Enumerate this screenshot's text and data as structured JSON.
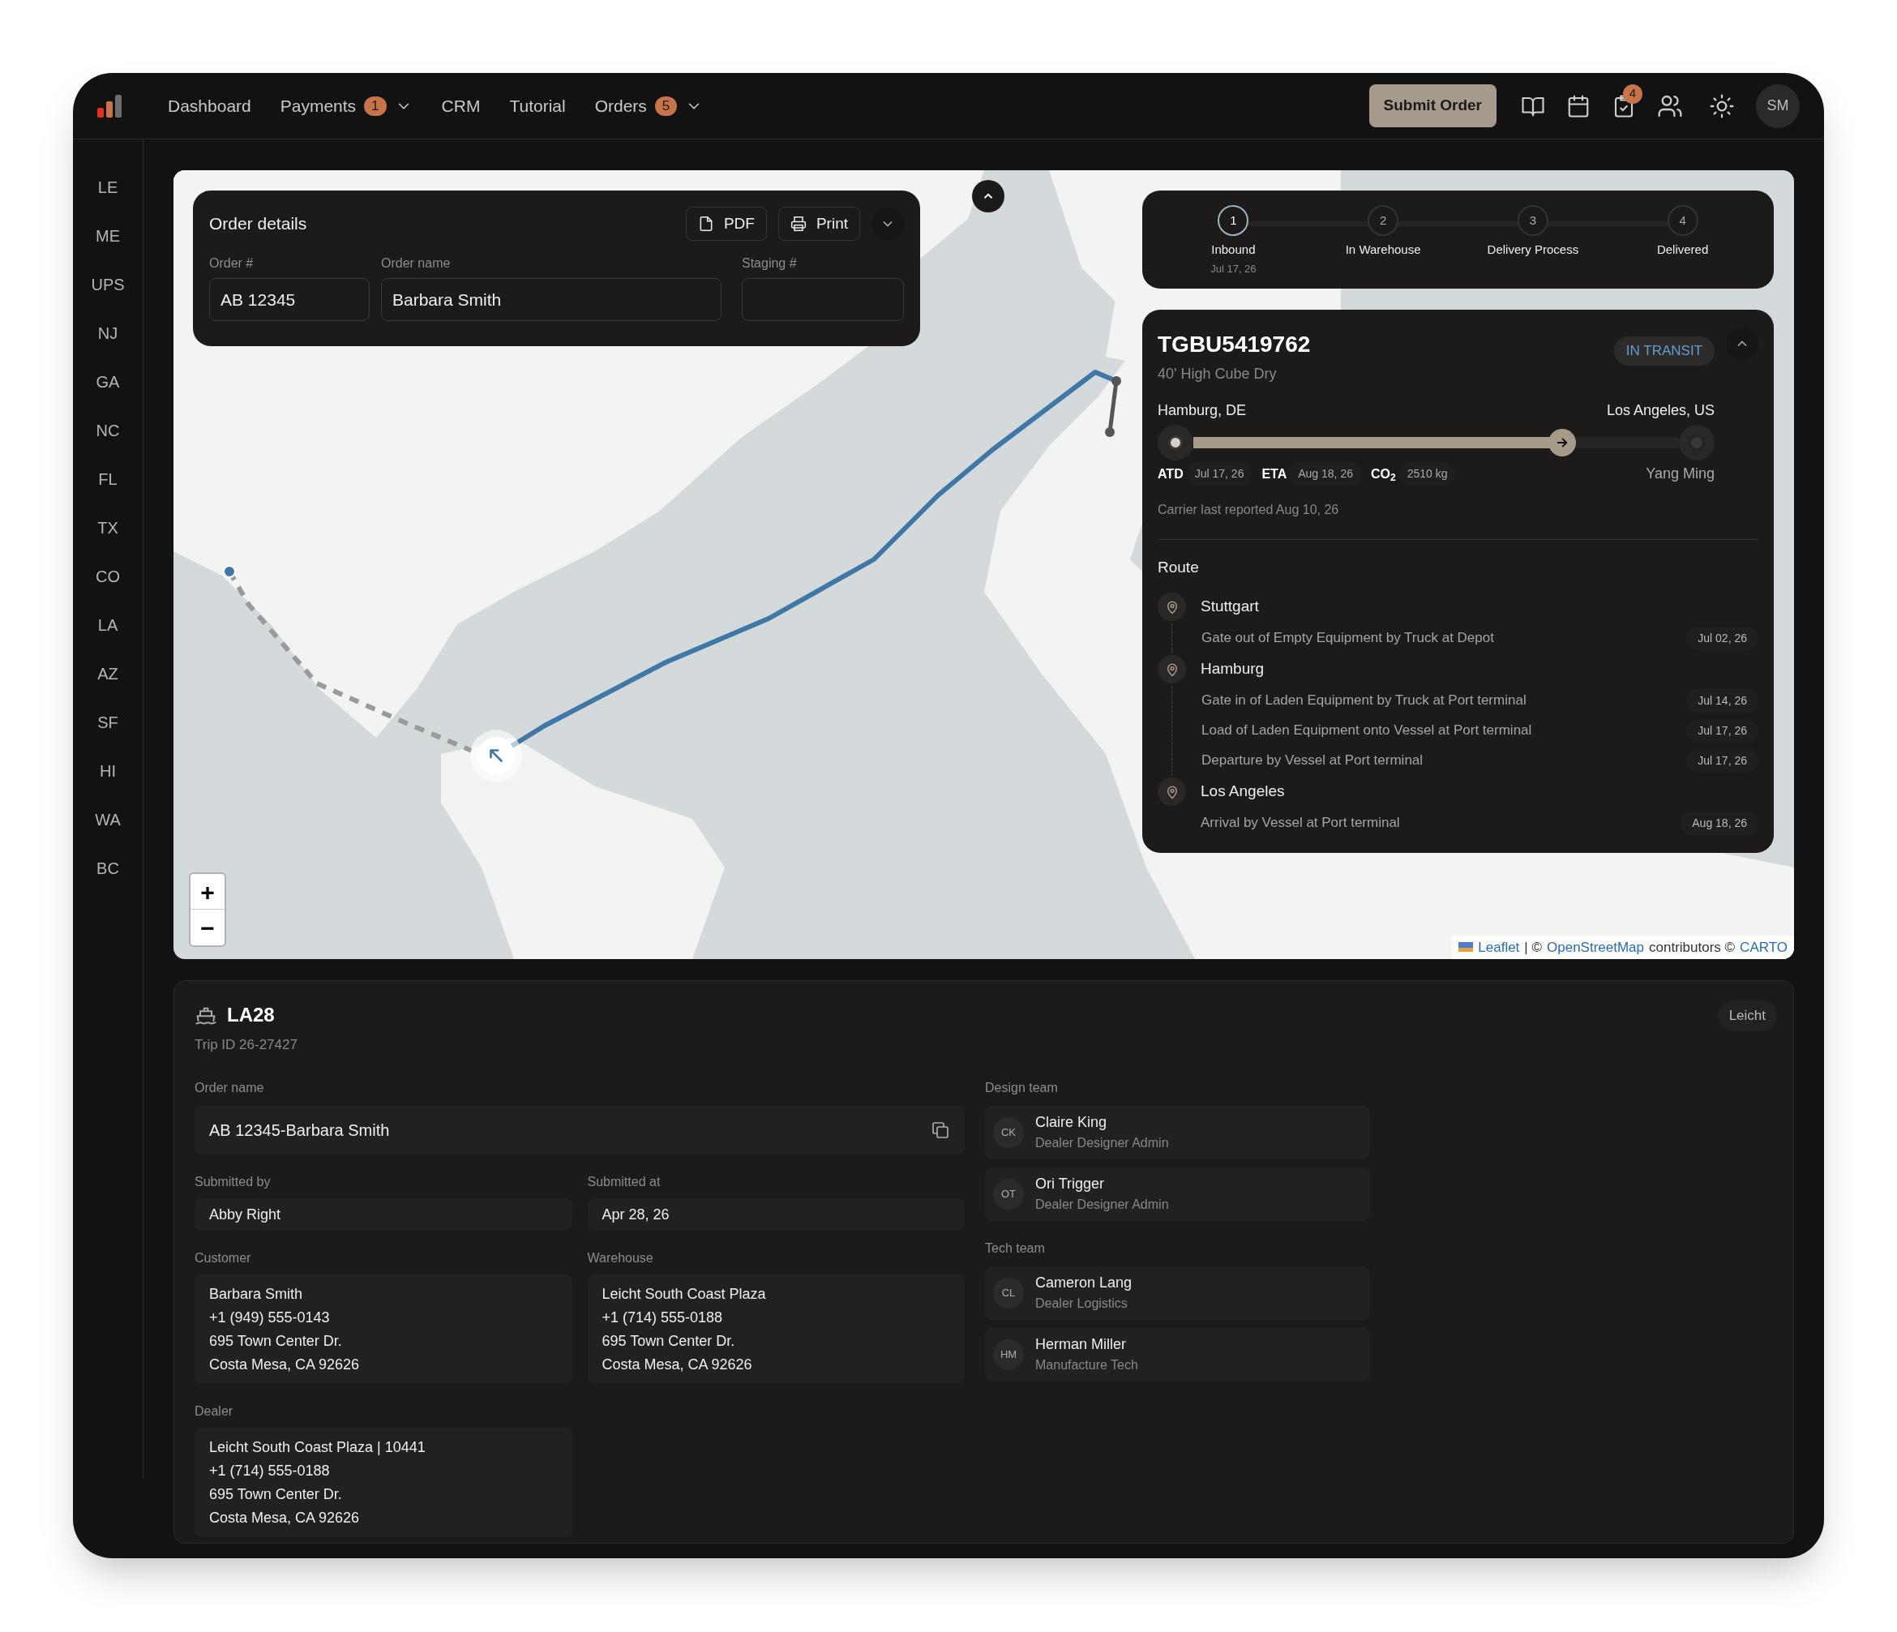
{
  "nav": {
    "items": [
      {
        "label": "Dashboard"
      },
      {
        "label": "Payments",
        "badge": "1",
        "dropdown": true
      },
      {
        "label": "CRM"
      },
      {
        "label": "Tutorial"
      },
      {
        "label": "Orders",
        "badge": "5",
        "dropdown": true
      }
    ],
    "submit_button": "Submit Order",
    "notification_badge": "4",
    "avatar": "SM"
  },
  "sidebar": {
    "items": [
      "LE",
      "ME",
      "UPS",
      "NJ",
      "GA",
      "NC",
      "FL",
      "TX",
      "CO",
      "LA",
      "AZ",
      "SF",
      "HI",
      "WA",
      "BC"
    ]
  },
  "order_details": {
    "title": "Order details",
    "buttons": [
      {
        "kind": "pdf",
        "label": "PDF"
      },
      {
        "kind": "print",
        "label": "Print"
      }
    ],
    "fields": [
      {
        "label": "Order #",
        "value": "AB 12345"
      },
      {
        "label": "Order name",
        "value": "Barbara Smith"
      },
      {
        "label": "Staging #"
      }
    ]
  },
  "stepper": {
    "steps": [
      {
        "number": "1",
        "label": "Inbound",
        "date": "Jul 17, 26",
        "selected": true
      },
      {
        "number": "2",
        "label": "In Warehouse",
        "selected": false
      },
      {
        "number": "3",
        "label": "Delivery Process",
        "selected": false
      },
      {
        "number": "4",
        "label": "Delivered",
        "selected": false
      }
    ]
  },
  "container": {
    "id": "TGBU5419762",
    "type": "40' High Cube Dry",
    "status": "IN TRANSIT",
    "origin": "Hamburg, DE",
    "destination": "Los Angeles, US",
    "level": 0.76,
    "facts": [
      {
        "label": "ATD",
        "value": "Jul 17, 26"
      },
      {
        "label": "ETA",
        "value": "Aug 18, 26"
      },
      {
        "label": "CO$_{2}$",
        "value": "2510 kg"
      }
    ],
    "carrier": "Yang Ming",
    "last_reported": "Carrier last reported Aug 10, 26",
    "route_title": "Route",
    "route": [
      {
        "place": "Stuttgart",
        "events": [
          {
            "text": "Gate out of Empty Equipment by Truck at Depot",
            "date": "Jul 02, 26"
          }
        ]
      },
      {
        "place": "Hamburg",
        "events": [
          {
            "text": "Gate in of Laden Equipment by Truck at Port terminal",
            "date": "Jul 14, 26"
          },
          {
            "text": "Load of Laden Equipment onto Vessel at Port terminal",
            "date": "Jul 17, 26"
          },
          {
            "text": "Departure by Vessel at Port terminal",
            "date": "Jul 17, 26"
          }
        ]
      },
      {
        "place": "Los Angeles",
        "events": [
          {
            "text": "Arrival by Vessel at Port terminal",
            "date": "Aug 18, 26"
          }
        ]
      }
    ]
  },
  "map": {
    "zoom_in": "+",
    "zoom_out": "−",
    "attribution": [
      {
        "kind": "link",
        "text": "Leaflet"
      },
      {
        "kind": "text",
        "text": "| ©"
      },
      {
        "kind": "link",
        "text": "OpenStreetMap"
      },
      {
        "kind": "text",
        "text": "contributors ©"
      },
      {
        "kind": "link",
        "text": "CARTO"
      }
    ]
  },
  "trip": {
    "title": "LA28",
    "trip_id": "Trip ID 26-27427",
    "tag": "Leicht",
    "order_name": {
      "label": "Order name",
      "value": "AB 12345-Barbara Smith"
    },
    "fields": [
      {
        "label": "Submitted by",
        "lines": [
          "Abby Right"
        ]
      },
      {
        "label": "Submitted at",
        "lines": [
          "Apr 28, 26"
        ]
      },
      {
        "label": "Customer",
        "lines": [
          "Barbara Smith",
          "+1 (949) 555-0143",
          "695 Town Center Dr.",
          "Costa Mesa, CA 92626"
        ]
      },
      {
        "label": "Warehouse",
        "lines": [
          "Leicht South Coast Plaza",
          "+1 (714) 555-0188",
          "695 Town Center Dr.",
          "Costa Mesa, CA 92626"
        ]
      },
      {
        "label": "Dealer",
        "lines": [
          "Leicht South Coast Plaza | 10441",
          "+1 (714) 555-0188",
          "695 Town Center Dr.",
          "Costa Mesa, CA 92626"
        ]
      }
    ],
    "teams": [
      {
        "title": "Design team",
        "members": [
          {
            "initials": "CK",
            "name": "Claire King",
            "role": "Dealer Designer Admin"
          },
          {
            "initials": "OT",
            "name": "Ori Trigger",
            "role": "Dealer Designer Admin"
          }
        ]
      },
      {
        "title": "Tech team",
        "members": [
          {
            "initials": "CL",
            "name": "Cameron Lang",
            "role": "Dealer Logistics"
          },
          {
            "initials": "HM",
            "name": "Herman Miller",
            "role": "Manufacture Tech"
          }
        ]
      }
    ]
  }
}
